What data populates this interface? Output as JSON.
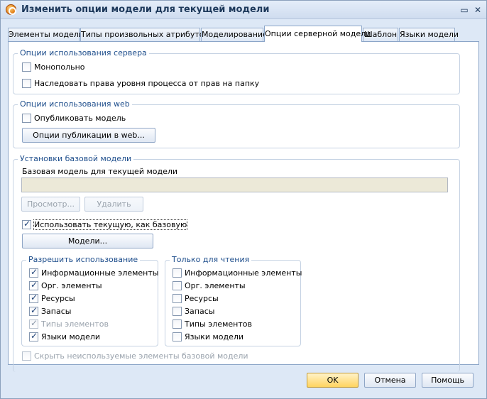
{
  "window": {
    "title": "Изменить опции модели для текущей модели",
    "minimize_glyph": "▭",
    "close_glyph": "✕"
  },
  "tabs": [
    {
      "label": "Элементы модели",
      "active": false
    },
    {
      "label": "Типы произвольных атрибутов",
      "active": false
    },
    {
      "label": "Моделирование",
      "active": false
    },
    {
      "label": "Опции серверной модели",
      "active": true
    },
    {
      "label": "Шаблон",
      "active": false
    },
    {
      "label": "Языки модели",
      "active": false
    }
  ],
  "server_options": {
    "title": "Опции использования сервера",
    "monopoly": {
      "label": "Монопольно",
      "checked": false
    },
    "inherit_rights": {
      "label": "Наследовать права уровня процесса от прав на папку",
      "checked": false
    }
  },
  "web_options": {
    "title": "Опции использования web",
    "publish_model": {
      "label": "Опубликовать модель",
      "checked": false
    },
    "publish_options_button": "Опции публикации в web..."
  },
  "base_model": {
    "title": "Установки базовой модели",
    "field_label": "Базовая модель для текущей модели",
    "field_value": "",
    "view_button": "Просмотр...",
    "delete_button": "Удалить",
    "use_current": {
      "label": "Использовать текущую, как базовую",
      "checked": true
    },
    "models_button": "Модели...",
    "allow_use": {
      "title": "Разрешить использование",
      "items": [
        {
          "label": "Информационные элементы",
          "checked": true,
          "disabled": false
        },
        {
          "label": "Орг. элементы",
          "checked": true,
          "disabled": false
        },
        {
          "label": "Ресурсы",
          "checked": true,
          "disabled": false
        },
        {
          "label": "Запасы",
          "checked": true,
          "disabled": false
        },
        {
          "label": "Типы элементов",
          "checked": true,
          "disabled": true
        },
        {
          "label": "Языки модели",
          "checked": true,
          "disabled": false
        }
      ]
    },
    "read_only": {
      "title": "Только для чтения",
      "items": [
        {
          "label": "Информационные элементы",
          "checked": false,
          "disabled": false
        },
        {
          "label": "Орг. элементы",
          "checked": false,
          "disabled": false
        },
        {
          "label": "Ресурсы",
          "checked": false,
          "disabled": false
        },
        {
          "label": "Запасы",
          "checked": false,
          "disabled": false
        },
        {
          "label": "Типы элементов",
          "checked": false,
          "disabled": false
        },
        {
          "label": "Языки модели",
          "checked": false,
          "disabled": false
        }
      ]
    },
    "hide_unused": {
      "label": "Скрыть неиспользуемые элементы базовой модели",
      "checked": false
    }
  },
  "footer": {
    "ok_button": "OK",
    "cancel_button": "Отмена",
    "help_button": "Помощь"
  }
}
